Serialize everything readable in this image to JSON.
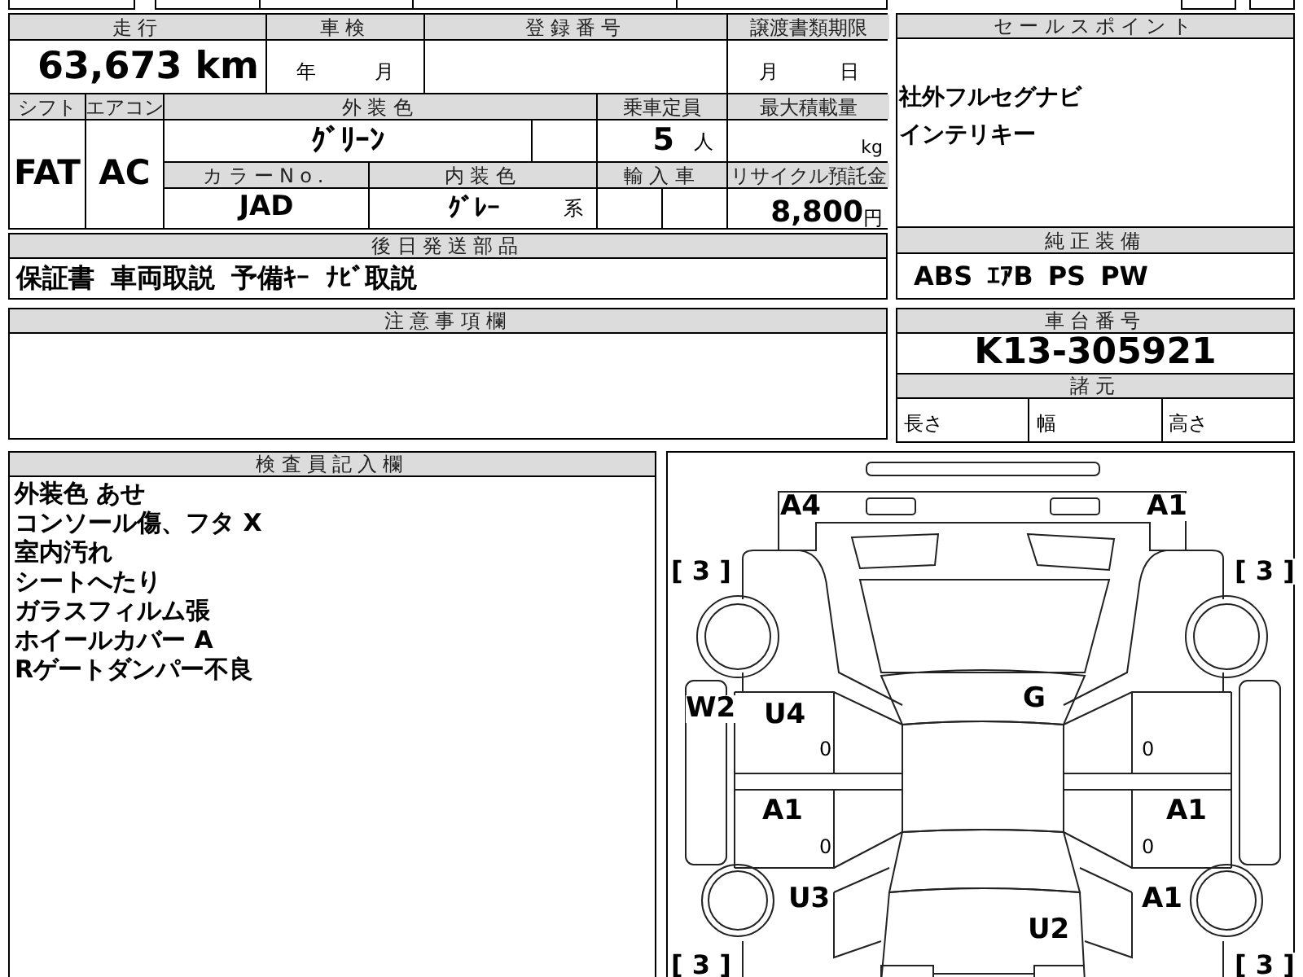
{
  "vehicle_table": {
    "headers": {
      "mileage": "走行",
      "inspection": "車検",
      "registration_number": "登録番号",
      "transfer_deadline": "譲渡書類期限",
      "shift": "シフト",
      "air_conditioner": "エアコン",
      "exterior_color": "外装色",
      "capacity": "乗車定員",
      "max_load": "最大積載量",
      "color_no": "カラーNo.",
      "interior_color": "内装色",
      "imported": "輸入車",
      "recycle_deposit": "リサイクル預託金"
    },
    "mileage": "63,673",
    "mileage_unit": "km",
    "inspection_year_unit": "年",
    "inspection_month_unit": "月",
    "transfer_month_unit": "月",
    "transfer_day_unit": "日",
    "shift": "FAT",
    "air_conditioner": "AC",
    "exterior_color": "ｸﾞﾘｰﾝ",
    "capacity": "5",
    "capacity_unit": "人",
    "max_load_unit": "kg",
    "color_no": "JAD",
    "interior_color": "ｸﾞﾚｰ",
    "interior_color_suffix": "系",
    "recycle_deposit": "8,800",
    "recycle_deposit_unit": "円"
  },
  "parts_to_ship": {
    "title": "後日発送部品",
    "items": [
      "保証書",
      "車両取説",
      "予備ｷｰ",
      "ﾅﾋﾞ取説"
    ]
  },
  "sales_points": {
    "title": "セールスポイント",
    "lines": [
      "社外フルセグナビ",
      "インテリキー"
    ]
  },
  "standard_equipment": {
    "title": "純正装備",
    "items": [
      "ABS",
      "ｴｱB",
      "PS",
      "PW"
    ]
  },
  "notes": {
    "title": "注意事項欄"
  },
  "chassis": {
    "title": "車台番号",
    "number": "K13-305921"
  },
  "specs": {
    "title": "諸元",
    "fields": [
      "長さ",
      "幅",
      "高さ"
    ]
  },
  "inspector_notes": {
    "title": "検査員記入欄",
    "lines": [
      "外装色 あせ",
      "コンソール傷、フタ X",
      "室内汚れ",
      "シートへたり",
      "ガラスフィルム張",
      "ホイールカバー A",
      "Rゲートダンパー不良"
    ]
  },
  "diagram": {
    "marks": [
      {
        "text": "A4",
        "kind": "damage"
      },
      {
        "text": "A1",
        "kind": "damage"
      },
      {
        "text": "[ 3 ]",
        "kind": "tread"
      },
      {
        "text": "[ 3 ]",
        "kind": "tread"
      },
      {
        "text": "W2",
        "kind": "damage"
      },
      {
        "text": "U4",
        "kind": "damage"
      },
      {
        "text": "G",
        "kind": "damage"
      },
      {
        "text": "0",
        "kind": "small"
      },
      {
        "text": "0",
        "kind": "small"
      },
      {
        "text": "A1",
        "kind": "damage"
      },
      {
        "text": "A1",
        "kind": "damage"
      },
      {
        "text": "0",
        "kind": "small"
      },
      {
        "text": "0",
        "kind": "small"
      },
      {
        "text": "U3",
        "kind": "damage"
      },
      {
        "text": "A1",
        "kind": "damage"
      },
      {
        "text": "U2",
        "kind": "damage"
      },
      {
        "text": "[ 3 ]",
        "kind": "tread"
      },
      {
        "text": "[ 3 ]",
        "kind": "tread"
      }
    ]
  }
}
